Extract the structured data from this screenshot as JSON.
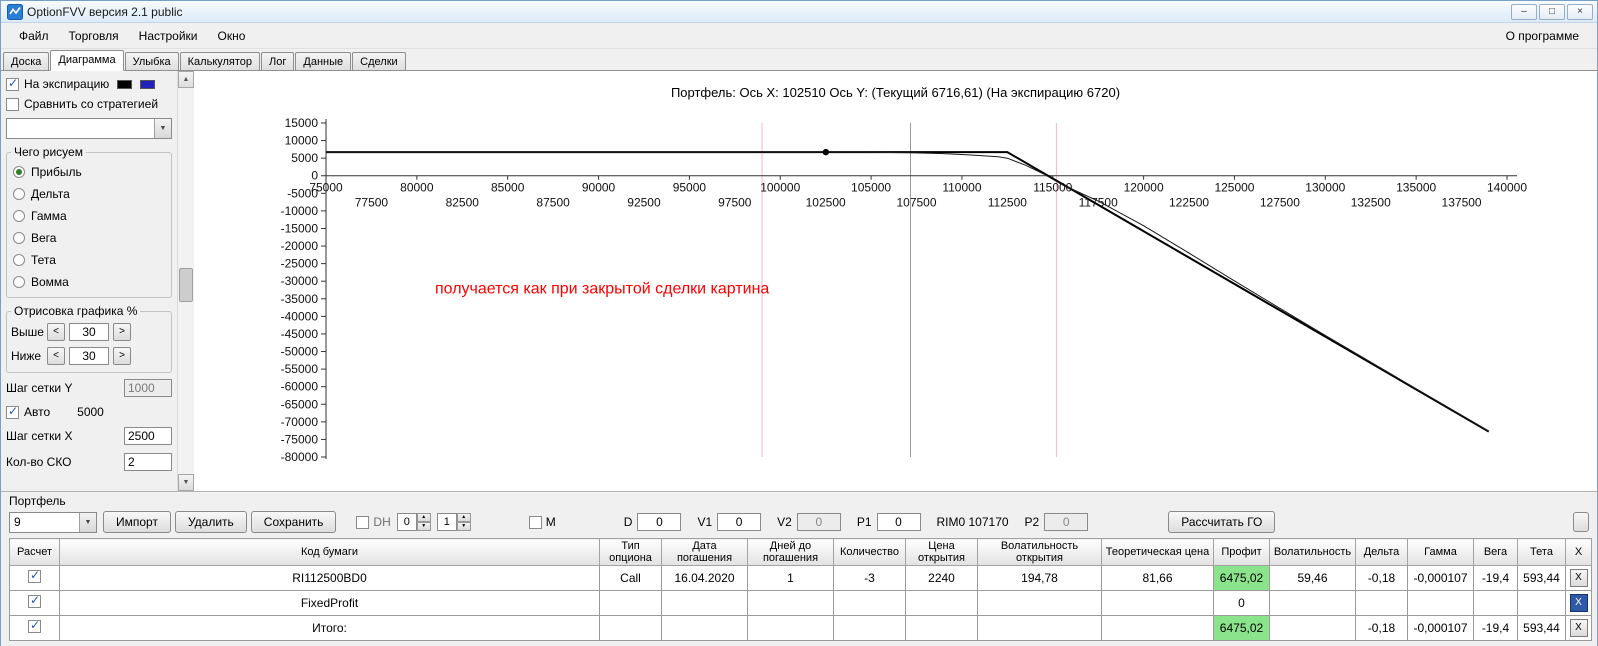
{
  "window": {
    "title": "OptionFVV версия 2.1 public",
    "caption_buttons": {
      "minimize": "–",
      "maximize": "□",
      "close": "×"
    }
  },
  "menu": {
    "items": [
      {
        "key": "file",
        "label": "Файл"
      },
      {
        "key": "trading",
        "label": "Торговля"
      },
      {
        "key": "settings",
        "label": "Настройки"
      },
      {
        "key": "window",
        "label": "Окно"
      }
    ],
    "about_label": "О программе"
  },
  "tabs": {
    "active": "Диаграмма",
    "items": [
      {
        "key": "board",
        "label": "Доска"
      },
      {
        "key": "diagram",
        "label": "Диаграмма"
      },
      {
        "key": "smile",
        "label": "Улыбка"
      },
      {
        "key": "calculator",
        "label": "Калькулятор"
      },
      {
        "key": "log",
        "label": "Лог"
      },
      {
        "key": "data",
        "label": "Данные"
      },
      {
        "key": "trades",
        "label": "Сделки"
      }
    ]
  },
  "sidebar": {
    "expiration_label": "На экспирацию",
    "expiration_swatches": [
      "#000000",
      "#2222bb"
    ],
    "compare_label": "Сравнить со стратегией",
    "draw_group": {
      "title": "Чего рисуем",
      "selected": "Прибыль",
      "options": [
        {
          "key": "profit",
          "label": "Прибыль"
        },
        {
          "key": "delta",
          "label": "Дельта"
        },
        {
          "key": "gamma",
          "label": "Гамма"
        },
        {
          "key": "vega",
          "label": "Вега"
        },
        {
          "key": "theta",
          "label": "Тета"
        },
        {
          "key": "vomma",
          "label": "Вомма"
        }
      ]
    },
    "render_group": {
      "title": "Отрисовка графика %",
      "rows": [
        {
          "key": "above",
          "label": "Выше",
          "value": "30"
        },
        {
          "key": "below",
          "label": "Ниже",
          "value": "30"
        }
      ]
    },
    "grid_y": {
      "label": "Шаг сетки Y",
      "value": "1000"
    },
    "auto": {
      "label": "Авто",
      "value": "5000",
      "checked": true
    },
    "grid_x": {
      "label": "Шаг сетки X",
      "value": "2500"
    },
    "sko": {
      "label": "Кол-во СКО",
      "value": "2"
    }
  },
  "chart_data": {
    "type": "line",
    "title": "Портфель: Ось X: 102510 Ось Y:  (Текущий 6716,61)  (На экспирацию 6720)",
    "xlabel": "",
    "ylabel": "",
    "grid": false,
    "legend_position": "none",
    "xlim": [
      75000,
      140000
    ],
    "ylim": [
      -80000,
      15000
    ],
    "y_tick_step": 5000,
    "x_major_ticks": [
      75000,
      80000,
      85000,
      90000,
      95000,
      100000,
      105000,
      110000,
      115000,
      120000,
      125000,
      130000,
      135000,
      140000
    ],
    "x_minor_ticks": [
      77500,
      82500,
      87500,
      92500,
      97500,
      102500,
      107500,
      112500,
      117500,
      122500,
      127500,
      132500,
      137500
    ],
    "series": [
      {
        "name": "expiration-payoff",
        "color": "#000000",
        "width": 2,
        "points": [
          [
            75000,
            6720
          ],
          [
            112500,
            6720
          ],
          [
            139000,
            -72780
          ]
        ]
      },
      {
        "name": "current-value",
        "color": "#1a1a1a",
        "width": 1,
        "points": [
          [
            75000,
            6716
          ],
          [
            100000,
            6716
          ],
          [
            103000,
            6710
          ],
          [
            105000,
            6680
          ],
          [
            107170,
            6560
          ],
          [
            109000,
            6300
          ],
          [
            110500,
            5900
          ],
          [
            112000,
            5400
          ],
          [
            112500,
            5000
          ],
          [
            113500,
            3000
          ],
          [
            114500,
            500
          ],
          [
            115500,
            -2500
          ],
          [
            117500,
            -7200
          ],
          [
            120000,
            -14200
          ],
          [
            122500,
            -22000
          ],
          [
            125000,
            -29900
          ],
          [
            127500,
            -37700
          ],
          [
            130000,
            -45400
          ],
          [
            132500,
            -53000
          ],
          [
            135000,
            -60600
          ],
          [
            137500,
            -68150
          ],
          [
            139000,
            -72680
          ]
        ]
      }
    ],
    "marker": {
      "x": 102510,
      "y": 6716.61
    },
    "vlines": [
      {
        "x": 107170,
        "color": "#9a9aa0",
        "name": "current-price-line"
      },
      {
        "x": 99000,
        "color": "#f5b8c4",
        "name": "sko-lower-line"
      },
      {
        "x": 115200,
        "color": "#f5b8c4",
        "name": "sko-upper-line"
      }
    ],
    "annotation": {
      "x": 81000,
      "y": -33500,
      "color": "#ff0000",
      "text": "получается как при закрытой сделки картина"
    }
  },
  "portfolio": {
    "label": "Портфель",
    "combo_value": "9",
    "import_label": "Импорт",
    "delete_label": "Удалить",
    "save_label": "Сохранить",
    "dh_label": "DH",
    "dh_spin1": "0",
    "dh_spin2": "1",
    "m_label": "M",
    "fields": [
      {
        "key": "d",
        "label": "D",
        "value": "0",
        "disabled": false
      },
      {
        "key": "v1",
        "label": "V1",
        "value": "0",
        "disabled": false
      },
      {
        "key": "v2",
        "label": "V2",
        "value": "0",
        "disabled": true
      },
      {
        "key": "p1",
        "label": "P1",
        "value": "0",
        "disabled": false
      }
    ],
    "rim_label": "RIM0 107170",
    "p2": {
      "label": "P2",
      "value": "0",
      "disabled": true
    },
    "calc_go_label": "Рассчитать ГО"
  },
  "table": {
    "columns": [
      "Расчет",
      "Код бумаги",
      "Тип опциона",
      "Дата погашения",
      "Дней до погашения",
      "Количество",
      "Цена открытия",
      "Волатильность открытия",
      "Теоретическая цена",
      "Профит",
      "Волатильность",
      "Дельта",
      "Гамма",
      "Вега",
      "Тета",
      "X"
    ],
    "remove_label": "X",
    "colors": {
      "profit_bg": "#8be48b"
    },
    "rows": [
      {
        "checked": true,
        "code": "RI112500BD0",
        "type": "Call",
        "expiry": "16.04.2020",
        "days": "1",
        "qty": "-3",
        "open_price": "2240",
        "open_vol": "194,78",
        "theo": "81,66",
        "profit": "6475,02",
        "profit_highlight": true,
        "vol": "59,46",
        "delta": "-0,18",
        "gamma": "-0,000107",
        "vega": "-19,4",
        "theta": "593,44",
        "x_focused": false
      },
      {
        "checked": true,
        "code": "FixedProfit",
        "type": "",
        "expiry": "",
        "days": "",
        "qty": "",
        "open_price": "",
        "open_vol": "",
        "theo": "",
        "profit": "0",
        "profit_highlight": false,
        "vol": "",
        "delta": "",
        "gamma": "",
        "vega": "",
        "theta": "",
        "x_focused": true
      },
      {
        "checked": true,
        "code": "Итого:",
        "type": "",
        "expiry": "",
        "days": "",
        "qty": "",
        "open_price": "",
        "open_vol": "",
        "theo": "",
        "profit": "6475,02",
        "profit_highlight": true,
        "vol": "",
        "delta": "-0,18",
        "gamma": "-0,000107",
        "vega": "-19,4",
        "theta": "593,44",
        "x_focused": false
      }
    ]
  }
}
